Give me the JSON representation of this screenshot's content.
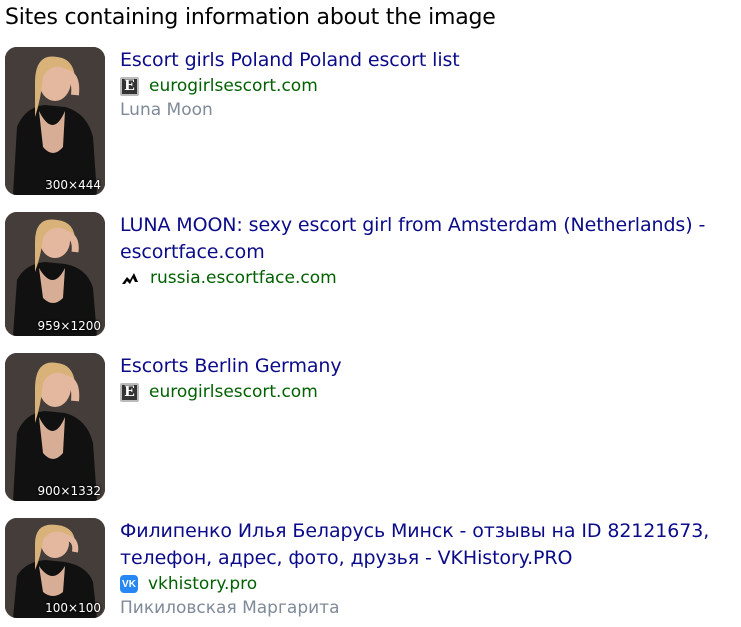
{
  "section_title": "Sites containing information about the image",
  "results": [
    {
      "title": "Escort girls Poland Poland escort list",
      "host": "eurogirlsescort.com",
      "favicon": "eurogirlsescort-favicon",
      "description": "Luna Moon",
      "image_size": "300×444"
    },
    {
      "title": "LUNA MOON: sexy escort girl from Amsterdam (Netherlands) - escortface.com",
      "host": "russia.escortface.com",
      "favicon": "escortface-favicon",
      "description": "",
      "image_size": "959×1200"
    },
    {
      "title": "Escorts Berlin Germany",
      "host": "eurogirlsescort.com",
      "favicon": "eurogirlsescort-favicon",
      "description": "",
      "image_size": "900×1332"
    },
    {
      "title": "Филипенко Илья Беларусь Минск - отзывы на ID 82121673, телефон, адрес, фото, друзья - VKHistory.PRO",
      "host": "vkhistory.pro",
      "favicon": "vk-favicon",
      "description": "Пикиловская Маргарита",
      "image_size": "100×100"
    }
  ]
}
